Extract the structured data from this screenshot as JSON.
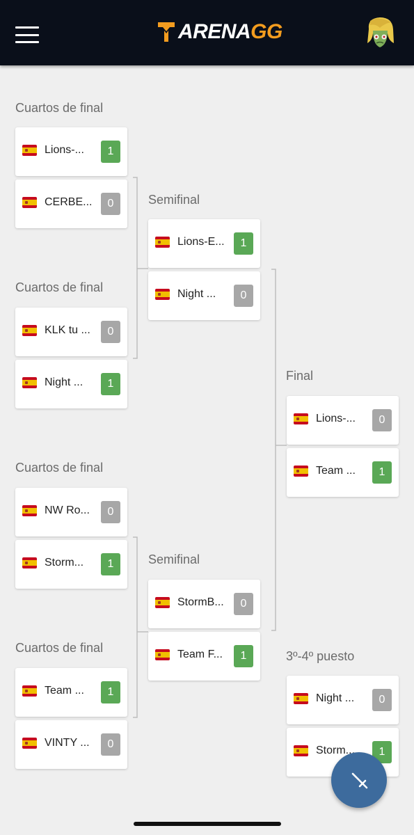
{
  "header": {
    "logo_left": "ARENA",
    "logo_right": "GG",
    "menu_icon": "hamburger-menu-icon",
    "avatar_icon": "zombie-avatar-icon",
    "colors": {
      "bar": "#0a0f1a",
      "logo_accent": "#f39c1f"
    }
  },
  "bracket": {
    "quarterfinals": [
      {
        "title": "Cuartos de final",
        "teams": [
          {
            "name": "Lions-...",
            "score": "1",
            "win": true
          },
          {
            "name": "CERBE...",
            "score": "0",
            "win": false
          }
        ]
      },
      {
        "title": "Cuartos de final",
        "teams": [
          {
            "name": "KLK tu ...",
            "score": "0",
            "win": false
          },
          {
            "name": "Night ...",
            "score": "1",
            "win": true
          }
        ]
      },
      {
        "title": "Cuartos de final",
        "teams": [
          {
            "name": "NW Ro...",
            "score": "0",
            "win": false
          },
          {
            "name": "Storm...",
            "score": "1",
            "win": true
          }
        ]
      },
      {
        "title": "Cuartos de final",
        "teams": [
          {
            "name": "Team ...",
            "score": "1",
            "win": true
          },
          {
            "name": "VINTY ...",
            "score": "0",
            "win": false
          }
        ]
      }
    ],
    "semifinals": [
      {
        "title": "Semifinal",
        "teams": [
          {
            "name": "Lions-E...",
            "score": "1",
            "win": true
          },
          {
            "name": "Night ...",
            "score": "0",
            "win": false
          }
        ]
      },
      {
        "title": "Semifinal",
        "teams": [
          {
            "name": "StormB...",
            "score": "0",
            "win": false
          },
          {
            "name": "Team F...",
            "score": "1",
            "win": true
          }
        ]
      }
    ],
    "final": {
      "title": "Final",
      "teams": [
        {
          "name": "Lions-...",
          "score": "0",
          "win": false
        },
        {
          "name": "Team ...",
          "score": "1",
          "win": true
        }
      ]
    },
    "third_place": {
      "title": "3º-4º puesto",
      "teams": [
        {
          "name": "Night ...",
          "score": "0",
          "win": false
        },
        {
          "name": "Storm...",
          "score": "1",
          "win": true
        }
      ]
    },
    "flag_icon": "spain-flag-icon",
    "colors": {
      "win": "#5aa856",
      "lose": "#a7a7a7"
    }
  },
  "fab": {
    "icon": "sword-icon",
    "color": "#3d6b9d"
  }
}
